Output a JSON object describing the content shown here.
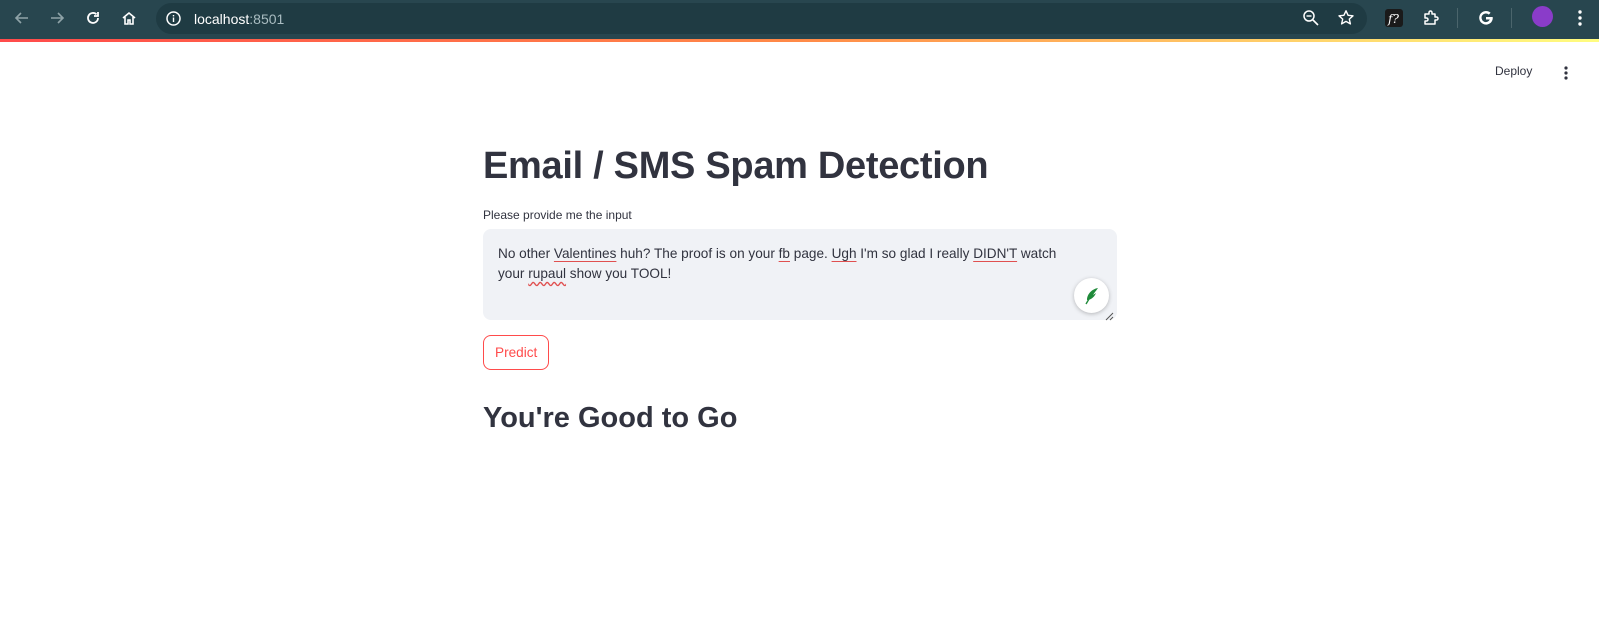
{
  "browser": {
    "url_host": "localhost",
    "url_port": ":8501",
    "icons": [
      "back-icon",
      "forward-icon",
      "reload-icon",
      "home-icon",
      "info-icon",
      "zoom-icon",
      "star-icon",
      "extension-fx-icon",
      "puzzle-icon",
      "google-icon",
      "profile-avatar",
      "menu-icon"
    ]
  },
  "header": {
    "deploy_label": "Deploy"
  },
  "main": {
    "title": "Email / SMS Spam Detection",
    "input_label": "Please provide me the input",
    "input_value_parts": [
      "No other ",
      "Valentines",
      " huh? The proof is on your ",
      "fb",
      " page. ",
      "Ugh",
      " I'm so glad I really ",
      "DIDN'T",
      " watch your ",
      "rupaul",
      " show you TOOL!"
    ],
    "predict_label": "Predict",
    "result_text": "You're Good to Go"
  },
  "colors": {
    "accent": "#ff4b4b",
    "text": "#31333f",
    "chrome_bg": "#28464f",
    "input_bg": "#f0f2f6"
  }
}
